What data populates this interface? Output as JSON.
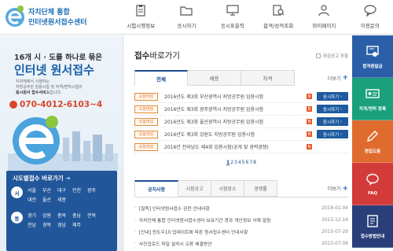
{
  "header": {
    "logo_line1": "자치단체 통합",
    "logo_line2": "인터넷원서접수센터",
    "nav": [
      {
        "label": "시험시행정보",
        "icon": "clipboard-icon"
      },
      {
        "label": "응시하기",
        "icon": "folder-icon"
      },
      {
        "label": "응시표출력",
        "icon": "monitor-icon"
      },
      {
        "label": "합격/성적조회",
        "icon": "search-list-icon"
      },
      {
        "label": "마이페이지",
        "icon": "user-icon"
      },
      {
        "label": "이용문의",
        "icon": "chat-icon"
      }
    ]
  },
  "banner": {
    "line1": "16개 시 · 도를 하나로 묶은",
    "line2": "인터넷 원서접수",
    "desc_lead": "지자체에서 시행하는",
    "desc_body": "지방공무원 임용시험 및 자격/면허시험의",
    "desc_strong": "응시원서 접수서비스",
    "desc_tail": "입니다.",
    "phone": "070-4012-6103~4",
    "region_title": "시도별접수 바로가기",
    "region_arrow": "➜",
    "regions": [
      {
        "circle": "서",
        "cities": [
          "서울",
          "부산",
          "대구",
          "인천",
          "광주",
          "대전",
          "울산",
          "세종"
        ]
      },
      {
        "circle": "동",
        "cities": [
          "경기",
          "강원",
          "충북",
          "충남",
          "전북",
          "전남",
          "경북",
          "경남",
          "제주"
        ]
      }
    ]
  },
  "main": {
    "title_bold": "접수",
    "title_rest": "바로가기",
    "closed_check": "마감공고 포함",
    "tabs": [
      "전체",
      "채용",
      "자격"
    ],
    "more": "더보기",
    "rows": [
      {
        "badge": "오늘마감",
        "title": "2016년도 제3회 부산광역시 지방공무원 임용시험",
        "new": "N",
        "button": "응시하기"
      },
      {
        "badge": "오늘마감",
        "title": "2016년도 제3회 광주광역시 지방공무원 임용시험",
        "new": "N",
        "button": "응시하기"
      },
      {
        "badge": "오늘마감",
        "title": "2016년도 제3회 울산광역시 지방공무원 임용시험",
        "new": "N",
        "button": "응시하기"
      },
      {
        "badge": "오늘마감",
        "title": "2016년도 제3회 강원도 지방공무원 임용시험",
        "new": "N",
        "button": "응시하기"
      },
      {
        "badge": "오늘마감",
        "title": "2016년 전라남도 제4회 임용시험(공개 및 경력경쟁)",
        "new": "N",
        "button": ""
      }
    ],
    "pages": [
      "1",
      "2",
      "3",
      "4",
      "5",
      "6",
      "7",
      "8"
    ],
    "notice_tabs": [
      "공지사항",
      "시험공고",
      "시험장소",
      "경쟁률"
    ],
    "notices": [
      {
        "title": "[필독] 인터넷원서접수 관련 안내사항",
        "date": "2016-01-04"
      },
      {
        "title": "자치단체 통합 인터넷원서접수센터 보유기간 경과 개인정보 삭제 알림",
        "date": "2015-12-16"
      },
      {
        "title": "[안내] 윈도우10 업데이트에 따른 원서접수센터 안내사항",
        "date": "2015-07-29"
      },
      {
        "title": "사진업로드 파일 설치시 오류 해결방안",
        "date": "2015-07-08"
      }
    ]
  },
  "quick": [
    {
      "label": "합격증발급",
      "color": "#2a5fa8",
      "icon": "certificate-icon"
    },
    {
      "label": "자격/면허 등록",
      "color": "#1aa07a",
      "icon": "id-card-icon"
    },
    {
      "label": "편집도움",
      "color": "#e06b2e",
      "icon": "pencil-icon"
    },
    {
      "label": "FAQ",
      "color": "#d33a3a",
      "icon": "faq-icon"
    },
    {
      "label": "접수방법안내",
      "color": "#2a3f7a",
      "icon": "guide-icon"
    }
  ],
  "colors": {
    "brand": "#1f6fb8",
    "accent_blue": "#1d5aa0",
    "phone_red": "#d9452b",
    "badge_orange": "#e06a1a"
  }
}
